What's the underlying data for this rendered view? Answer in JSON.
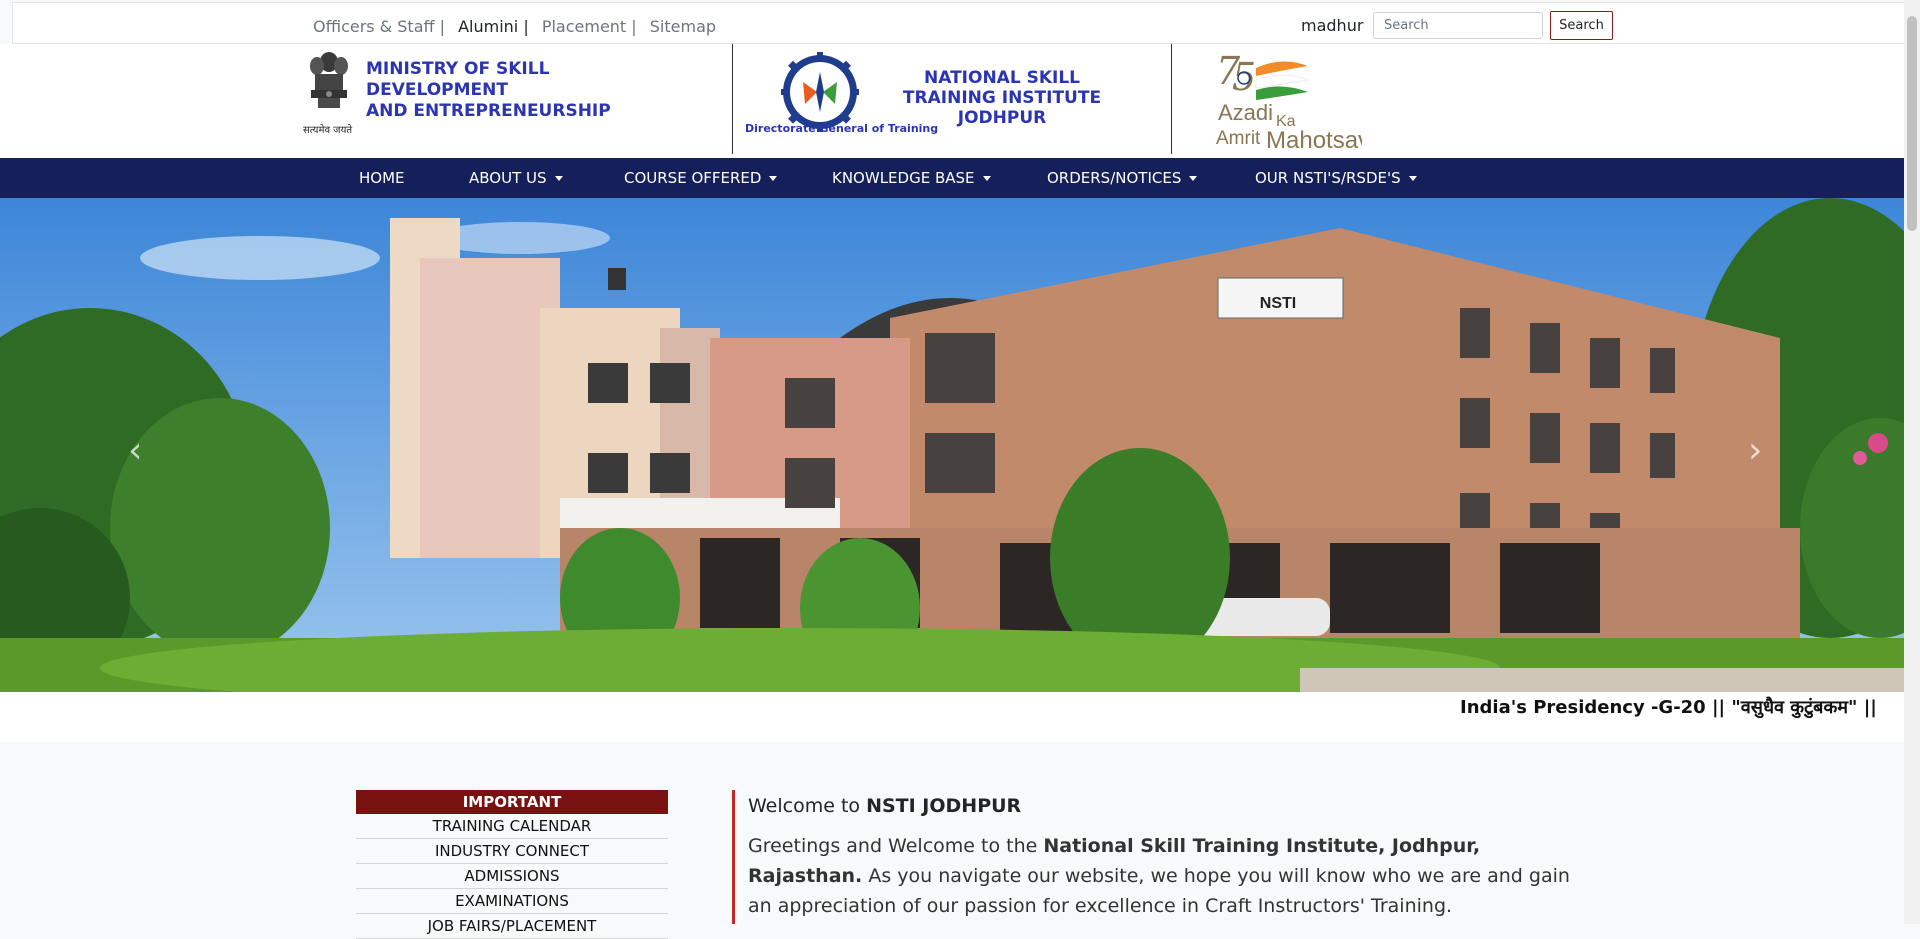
{
  "topbar": {
    "links": [
      "Officers & Staff |",
      "Alumini |",
      "Placement |",
      "Sitemap"
    ],
    "user": "madhur",
    "search_placeholder": "Search",
    "search_button": "Search"
  },
  "header": {
    "emblem_caption": "सत्यमेव जयते",
    "ministry_line1": "MINISTRY OF SKILL",
    "ministry_line2": "DEVELOPMENT",
    "ministry_line3": "AND ENTREPRENEURSHIP",
    "dgt_caption": "Directorate General of Training",
    "nsti_line1": "NATIONAL SKILL",
    "nsti_line2": "TRAINING INSTITUTE",
    "nsti_line3": "JODHPUR",
    "azadi_line1": "Azadi",
    "azadi_ka": "Ka",
    "azadi_line2": "Amrit",
    "azadi_line3": "Mahotsav"
  },
  "nav": {
    "items": [
      "HOME",
      "ABOUT US",
      "COURSE OFFERED",
      "KNOWLEDGE BASE",
      "ORDERS/NOTICES",
      "OUR NSTI'S/RSDE'S"
    ]
  },
  "carousel": {
    "sign_text": "NSTI"
  },
  "marquee": {
    "text": "India's Presidency -G-20   ||  \"वसुधैव कुटुंबकम\"   ||"
  },
  "important": {
    "heading": "IMPORTANT",
    "items": [
      "TRAINING CALENDAR",
      "INDUSTRY CONNECT",
      "ADMISSIONS",
      "EXAMINATIONS",
      "JOB FAIRS/PLACEMENT"
    ]
  },
  "welcome": {
    "prefix": "Welcome to ",
    "title_bold": "NSTI JODHPUR",
    "para_prefix": "Greetings and Welcome to the ",
    "para_bold": "National Skill Training Institute, Jodhpur, Rajasthan.",
    "para_rest": " As you navigate our website, we hope you will know who we are and gain an appreciation of our passion for excellence in Craft Instructors' Training."
  },
  "colors": {
    "nav_bg": "#15205a",
    "brand_blue": "#2b35b3",
    "important_red": "#7a1111",
    "accent_red": "#c0282a"
  }
}
